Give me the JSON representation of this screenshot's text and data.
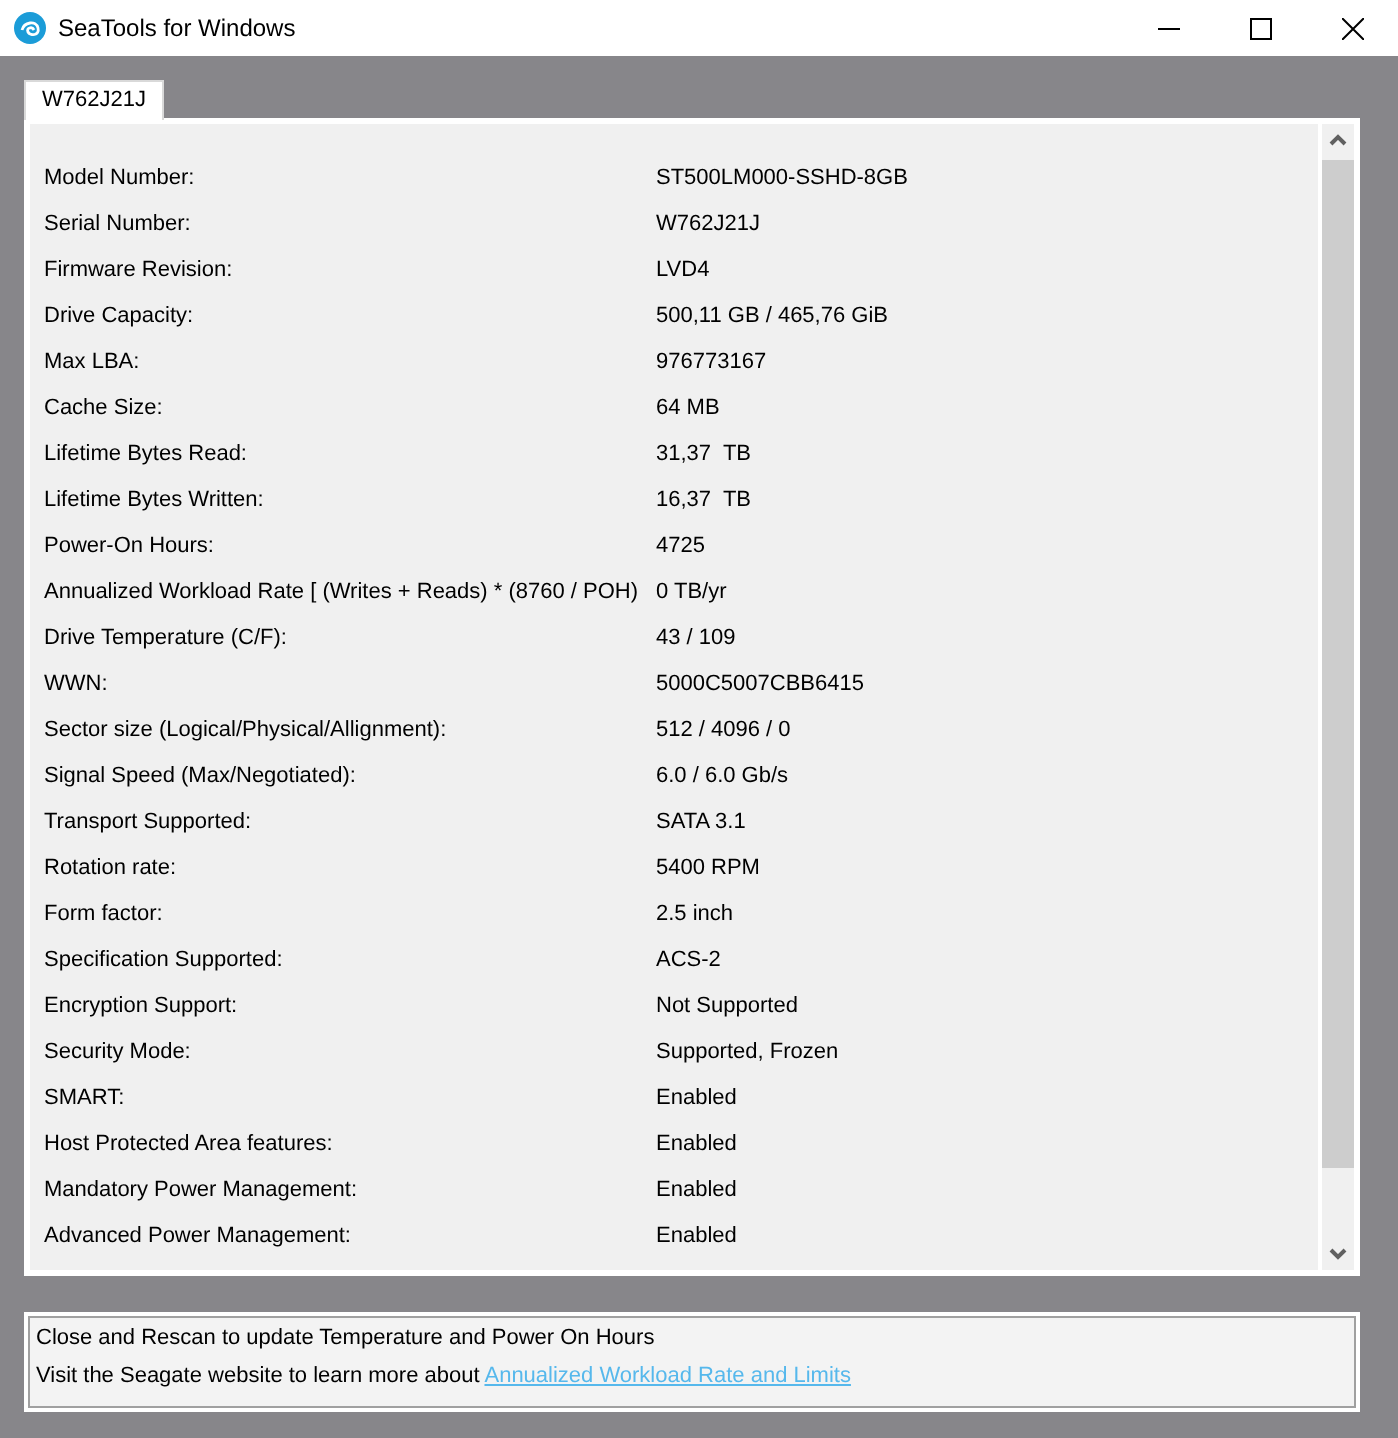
{
  "window": {
    "title": "SeaTools for Windows",
    "controls": [
      {
        "kind": "minimize"
      },
      {
        "kind": "maximize"
      },
      {
        "kind": "close"
      }
    ]
  },
  "tabs": [
    {
      "label": "W762J21J",
      "selected": true
    }
  ],
  "details": [
    {
      "label": "Model Number:",
      "value": "ST500LM000-SSHD-8GB"
    },
    {
      "label": "Serial Number:",
      "value": "W762J21J"
    },
    {
      "label": "Firmware Revision:",
      "value": "LVD4"
    },
    {
      "label": "Drive Capacity:",
      "value": "500,11 GB / 465,76 GiB"
    },
    {
      "label": "Max LBA:",
      "value": "976773167"
    },
    {
      "label": "Cache Size:",
      "value": "64 MB"
    },
    {
      "label": "Lifetime Bytes Read:",
      "value": "31,37  TB"
    },
    {
      "label": "Lifetime Bytes Written:",
      "value": "16,37  TB"
    },
    {
      "label": "Power-On Hours:",
      "value": "4725"
    },
    {
      "label": "Annualized Workload Rate [ (Writes + Reads) * (8760 / POH)",
      "value": "0 TB/yr"
    },
    {
      "label": "Drive Temperature (C/F):",
      "value": "43 / 109"
    },
    {
      "label": "WWN:",
      "value": "5000C5007CBB6415"
    },
    {
      "label": "Sector size (Logical/Physical/Allignment):",
      "value": "512 / 4096 / 0"
    },
    {
      "label": "Signal Speed (Max/Negotiated):",
      "value": "6.0 / 6.0 Gb/s"
    },
    {
      "label": "Transport Supported:",
      "value": "SATA 3.1"
    },
    {
      "label": "Rotation rate:",
      "value": "5400 RPM"
    },
    {
      "label": "Form factor:",
      "value": "2.5 inch"
    },
    {
      "label": "Specification Supported:",
      "value": "ACS-2"
    },
    {
      "label": "Encryption Support:",
      "value": "Not Supported"
    },
    {
      "label": "Security Mode:",
      "value": "Supported, Frozen"
    },
    {
      "label": "SMART:",
      "value": "Enabled"
    },
    {
      "label": "Host Protected Area features:",
      "value": "Enabled"
    },
    {
      "label": "Mandatory Power Management:",
      "value": "Enabled"
    },
    {
      "label": "Advanced Power Management:",
      "value": "Enabled"
    }
  ],
  "notes": {
    "line_1": "Close and Rescan to update Temperature and Power On Hours",
    "line_2": "Visit the Seagate website to learn more about",
    "link": "Annualized Workload Rate and Limits"
  }
}
